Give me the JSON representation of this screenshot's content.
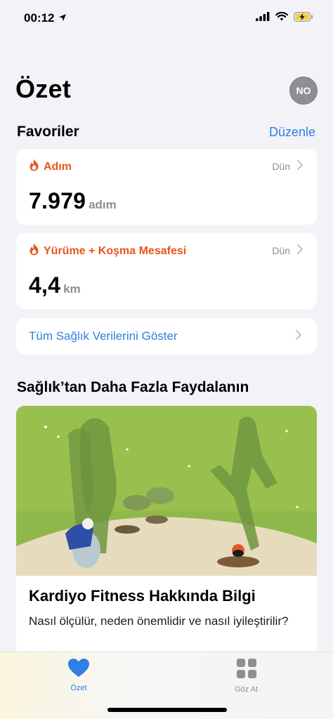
{
  "status": {
    "time": "00:12"
  },
  "header": {
    "title": "Özet",
    "avatar_initials": "NO"
  },
  "favorites": {
    "title": "Favoriler",
    "edit_label": "Düzenle",
    "cards": [
      {
        "label": "Adım",
        "date": "Dün",
        "value": "7.979",
        "unit": "adım"
      },
      {
        "label": "Yürüme + Koşma Mesafesi",
        "date": "Dün",
        "value": "4,4",
        "unit": "km"
      }
    ],
    "show_all_label": "Tüm Sağlık Verilerini Göster"
  },
  "more": {
    "title": "Sağlık’tan Daha Fazla Faydalanın",
    "article": {
      "title": "Kardiyo Fitness Hakkında Bilgi",
      "subtitle": "Nasıl ölçülür, neden önemlidir ve nasıl iyileştirilir?"
    }
  },
  "tabs": [
    {
      "label": "Özet",
      "icon": "heart-icon",
      "active": true
    },
    {
      "label": "Göz At",
      "icon": "grid-icon",
      "active": false
    }
  ],
  "colors": {
    "accent": "#2e7fe0",
    "activity": "#e8541d",
    "tab_active": "#2f7fe6",
    "tab_inactive": "#8e8e93"
  }
}
